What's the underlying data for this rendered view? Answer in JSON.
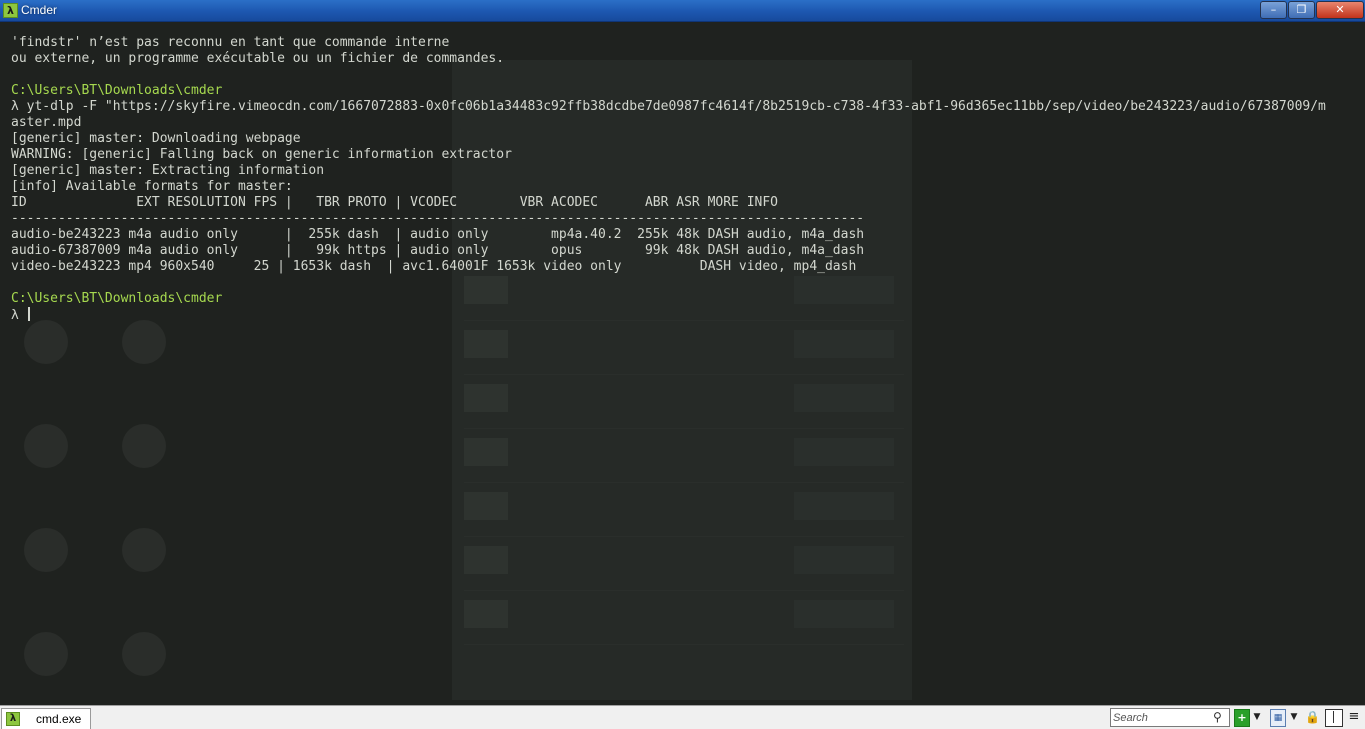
{
  "window": {
    "title": "Cmder",
    "app_icon_glyph": "λ",
    "minimize_glyph": "–",
    "maximize_glyph": "❐",
    "close_glyph": "✕"
  },
  "terminal": {
    "lines": [
      {
        "text": "'findstr' n’est pas reconnu en tant que commande interne",
        "style": "output"
      },
      {
        "text": "ou externe, un programme exécutable ou un fichier de commandes.",
        "style": "output"
      },
      {
        "text": "",
        "style": "output"
      },
      {
        "text": "C:\\Users\\BT\\Downloads\\cmder",
        "style": "path"
      },
      {
        "text": "λ yt-dlp -F \"https://skyfire.vimeocdn.com/1667072883-0x0fc06b1a34483c92ffb38dcdbe7de0987fc4614f/8b2519cb-c738-4f33-abf1-96d365ec11bb/sep/video/be243223/audio/67387009/m",
        "style": "output"
      },
      {
        "text": "aster.mpd",
        "style": "output"
      },
      {
        "text": "[generic] master: Downloading webpage",
        "style": "output"
      },
      {
        "text": "WARNING: [generic] Falling back on generic information extractor",
        "style": "output"
      },
      {
        "text": "[generic] master: Extracting information",
        "style": "output"
      },
      {
        "text": "[info] Available formats for master:",
        "style": "output"
      },
      {
        "text": "ID              EXT RESOLUTION FPS |   TBR PROTO | VCODEC        VBR ACODEC      ABR ASR MORE INFO",
        "style": "output"
      },
      {
        "text": "-------------------------------------------------------------------------------------------------------------",
        "style": "output"
      },
      {
        "text": "audio-be243223 m4a audio only      |  255k dash  | audio only        mp4a.40.2  255k 48k DASH audio, m4a_dash",
        "style": "output"
      },
      {
        "text": "audio-67387009 m4a audio only      |   99k https | audio only        opus        99k 48k DASH audio, m4a_dash",
        "style": "output"
      },
      {
        "text": "video-be243223 mp4 960x540     25 | 1653k dash  | avc1.64001F 1653k video only          DASH video, mp4_dash",
        "style": "output"
      },
      {
        "text": "",
        "style": "output"
      },
      {
        "text": "C:\\Users\\BT\\Downloads\\cmder",
        "style": "path"
      },
      {
        "text": "λ ",
        "style": "prompt"
      }
    ]
  },
  "statusbar": {
    "tab_label": "cmd.exe",
    "tab_icon_glyph": "λ",
    "search_placeholder": "Search",
    "search_glyph": "⚲",
    "new_console_glyph": "+",
    "dropdown_glyph": "▼",
    "panes_glyph": "▦",
    "lock_glyph": "🔒",
    "menu_glyph": "≡"
  },
  "colors": {
    "background": "#1f221f",
    "foreground": "#d3d7cf",
    "path": "#a6d94f",
    "titlebar": "#1d57b0"
  }
}
